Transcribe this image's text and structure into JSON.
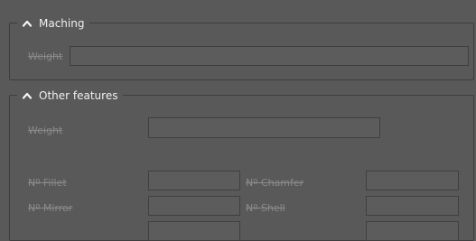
{
  "machining": {
    "title": "Maching",
    "weight_label": "Weight",
    "weight_value": ""
  },
  "other_features": {
    "title": "Other features",
    "weight_label": "Weight",
    "weight_value": "",
    "fillet_label": "Nº Fillet",
    "fillet_value": "",
    "chamfer_label": "Nº Chamfer",
    "chamfer_value": "",
    "mirror_label": "Nº Mirror",
    "mirror_value": "",
    "shell_label": "Nº Shell",
    "shell_value": "",
    "extra_left_value": "",
    "extra_right_value": ""
  },
  "icons": {
    "collapse": "chevron-up-icon"
  }
}
